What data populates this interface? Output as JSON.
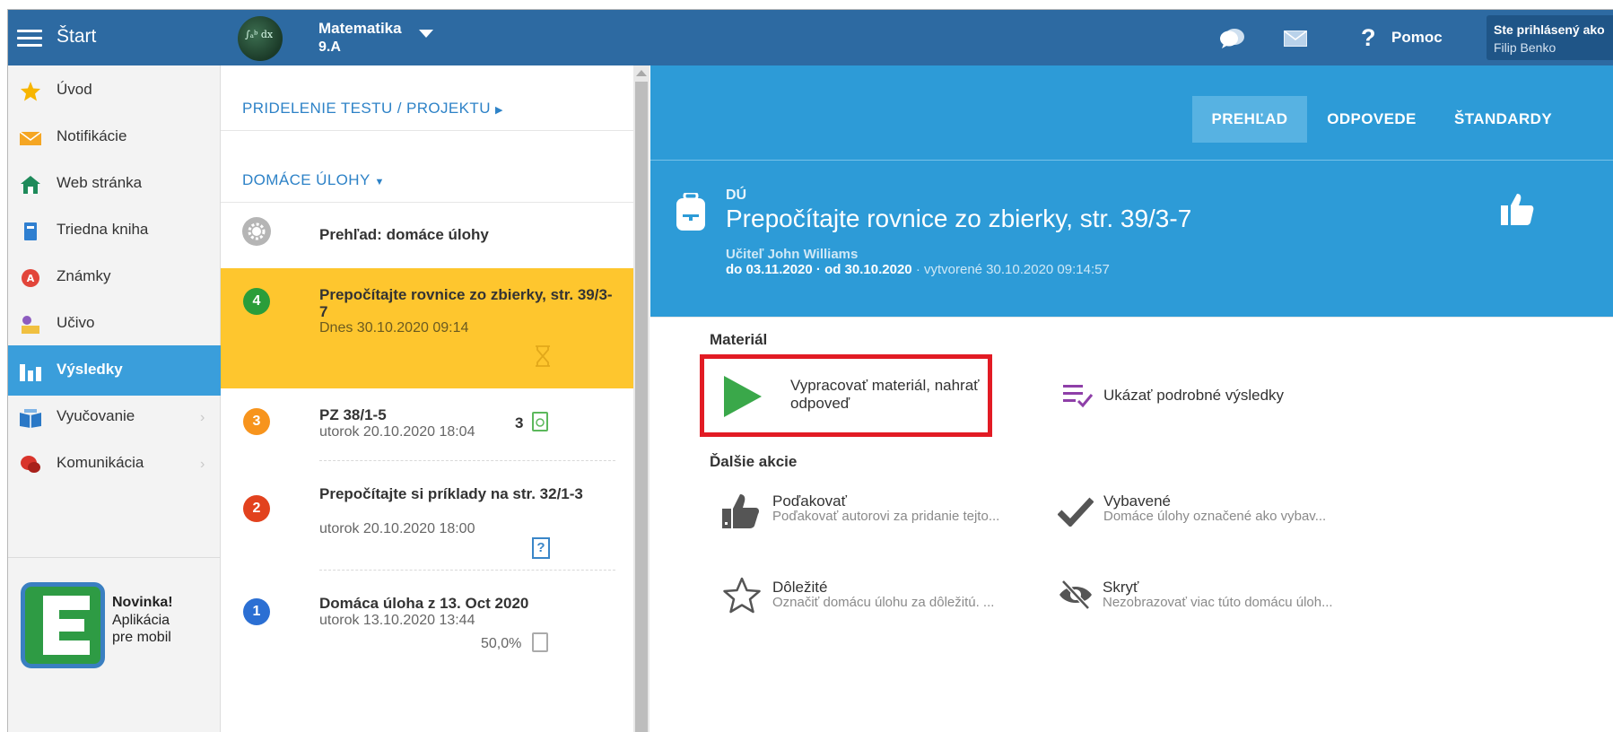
{
  "topbar": {
    "start_label": "Štart",
    "subject": "Matematika",
    "class_name": "9.A",
    "avatar_text": "∫ₐᵇ dx",
    "help_q": "?",
    "help_label": "Pomoc",
    "user_line1": "Ste prihlásený ako",
    "user_line2": "Filip Benko"
  },
  "sidebar": {
    "items": [
      {
        "label": "Úvod",
        "icon": "star-icon"
      },
      {
        "label": "Notifikácie",
        "icon": "envelope-icon"
      },
      {
        "label": "Web stránka",
        "icon": "home-icon"
      },
      {
        "label": "Triedna kniha",
        "icon": "book-icon"
      },
      {
        "label": "Známky",
        "icon": "grades-icon"
      },
      {
        "label": "Učivo",
        "icon": "curriculum-icon"
      },
      {
        "label": "Výsledky",
        "icon": "bar-chart-icon"
      },
      {
        "label": "Vyučovanie",
        "icon": "open-book-icon"
      },
      {
        "label": "Komunikácia",
        "icon": "chat-icon"
      }
    ],
    "arrow": "›",
    "promo": {
      "title": "Novinka!",
      "line2": "Aplikácia",
      "line3": "pre mobil"
    }
  },
  "middle": {
    "assign_link": "PRIDELENIE TESTU / PROJEKTU",
    "homework_link": "DOMÁCE ÚLOHY",
    "overview": "Prehľad: domáce úlohy",
    "tasks": [
      {
        "num": "4",
        "title": "Prepočítajte rovnice zo zbierky, str. 39/3-7",
        "date": "Dnes 30.10.2020 09:14",
        "color": "#2a9d3a"
      },
      {
        "num": "3",
        "title": "PZ 38/1-5",
        "date": "utorok 20.10.2020 18:04",
        "count": "3",
        "color": "#f7941d"
      },
      {
        "num": "2",
        "title": "Prepočítajte si príklady na str. 32/1-3",
        "date": "utorok 20.10.2020 18:00",
        "q": "?",
        "color": "#e2421e"
      },
      {
        "num": "1",
        "title": "Domáca úloha z 13. Oct 2020",
        "date": "utorok 13.10.2020 13:44",
        "pct": "50,0%",
        "color": "#2b6fd3"
      }
    ]
  },
  "right": {
    "tabs": [
      "PREHĽAD",
      "ODPOVEDE",
      "ŠTANDARDY"
    ],
    "kind": "DÚ",
    "title": "Prepočítajte rovnice zo zbierky, str. 39/3-7",
    "teacher": "Učiteľ John Williams",
    "due": "do 03.11.2020 · od 30.10.2020",
    "created": "· vytvorené 30.10.2020 09:14:57",
    "material_label": "Materiál",
    "work_title_1": "Vypracovať materiál, nahrať",
    "work_title_2": "odpoveď",
    "results_title": "Ukázať podrobné výsledky",
    "more_label": "Ďalšie akcie",
    "thank_title": "Poďakovať",
    "thank_desc": "Poďakovať autorovi za pridanie tejto...",
    "done_title": "Vybavené",
    "done_desc": "Domáce úlohy označené ako vybav...",
    "important_title": "Dôležité",
    "important_desc": "Označiť domácu úlohu za dôležitú. ...",
    "hide_title": "Skryť",
    "hide_desc": "Nezobrazovať viac túto domácu úloh..."
  },
  "colors": {
    "topbar": "#2d6aa2",
    "accent": "#2d9bd7",
    "active_task": "#fec62e",
    "highlight": "#e21b24",
    "play": "#3aa84a",
    "results": "#8e3fa8"
  }
}
